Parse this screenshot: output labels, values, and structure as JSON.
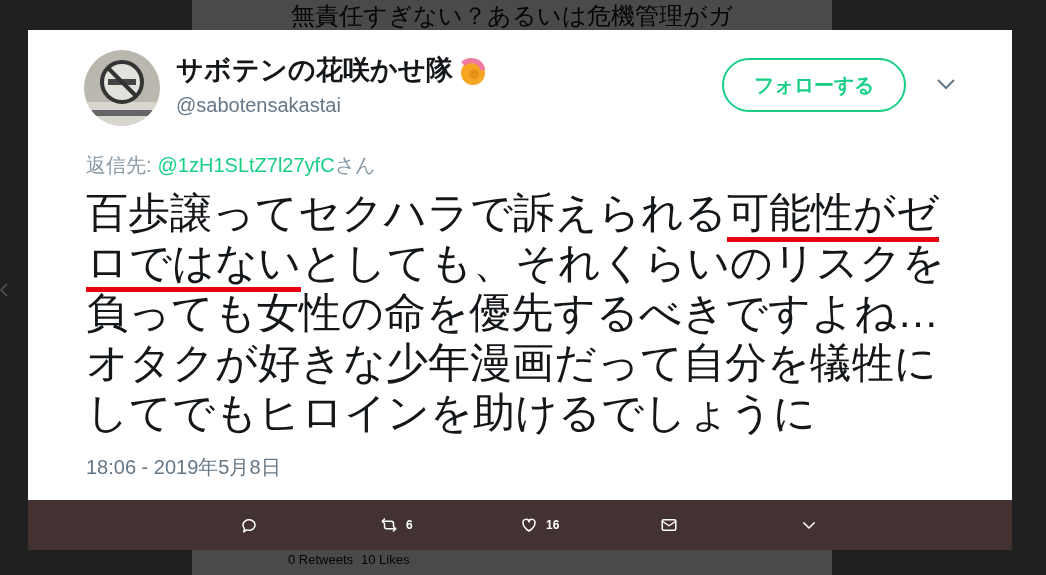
{
  "background_tweet": {
    "text": "無責任すぎない？あるいは危機管理がガ",
    "retweets": "0 Retweets",
    "likes": "10 Likes"
  },
  "tweet": {
    "display_name": "サボテンの花咲かせ隊",
    "handle": "@sabotensakastai",
    "follow_button": "フォローする",
    "reply_prefix": "返信先:",
    "reply_to": "@1zH1SLtZ7l27yfC",
    "reply_suffix": "さん",
    "segments": [
      {
        "text": "百歩譲ってセクハラで訴えられる",
        "underlined": false
      },
      {
        "text": "可能性がゼロではない",
        "underlined": true
      },
      {
        "text": "としても、それくらいのリスクを負っても女性の命を優先するべきですよね…オタクが好きな少年漫画だって自分を犠牲にしてでもヒロインを助けるでしょうに",
        "underlined": false
      }
    ],
    "timestamp": "18:06 - 2019年5月8日",
    "actions": [
      {
        "kind": "reply"
      },
      {
        "kind": "retweet",
        "count": "6"
      },
      {
        "kind": "like",
        "count": "16"
      },
      {
        "kind": "message"
      },
      {
        "kind": "more"
      }
    ]
  }
}
